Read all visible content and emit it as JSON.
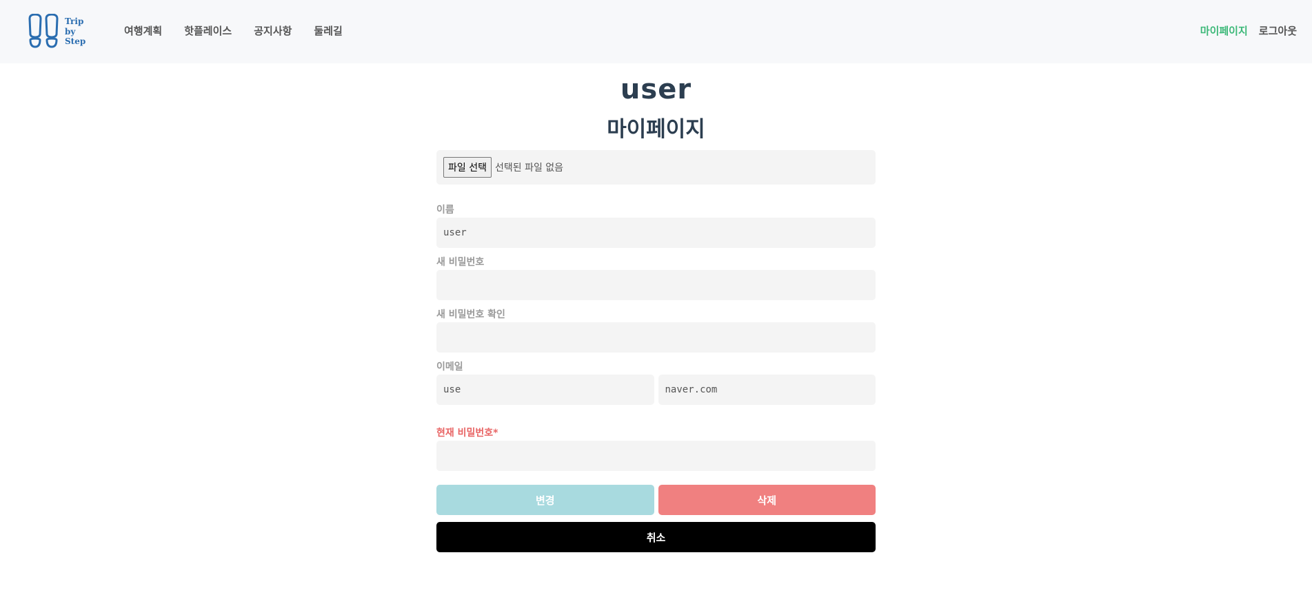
{
  "nav": {
    "logo_lines": [
      "Trip",
      "by",
      "Step"
    ],
    "left_items": [
      "여행계획",
      "핫플레이스",
      "공지사항",
      "둘레길"
    ],
    "mypage": "마이페이지",
    "logout": "로그아웃",
    "active_color": "#3cb878"
  },
  "profile": {
    "username": "user",
    "title": "마이페이지",
    "file_button": "파일 선택",
    "file_status": "선택된 파일 없음"
  },
  "form": {
    "name_label": "이름",
    "name_value": "user",
    "new_password_label": "새 비밀번호",
    "new_password_confirm_label": "새 비밀번호 확인",
    "email_label": "이메일",
    "email_id": "use",
    "email_domain": "naver.com",
    "current_password_label": "현재 비밀번호*"
  },
  "actions": {
    "change": "변경",
    "delete": "삭제",
    "cancel": "취소",
    "change_color": "#a8dadf",
    "delete_color": "#f08080",
    "cancel_color": "#000000"
  }
}
